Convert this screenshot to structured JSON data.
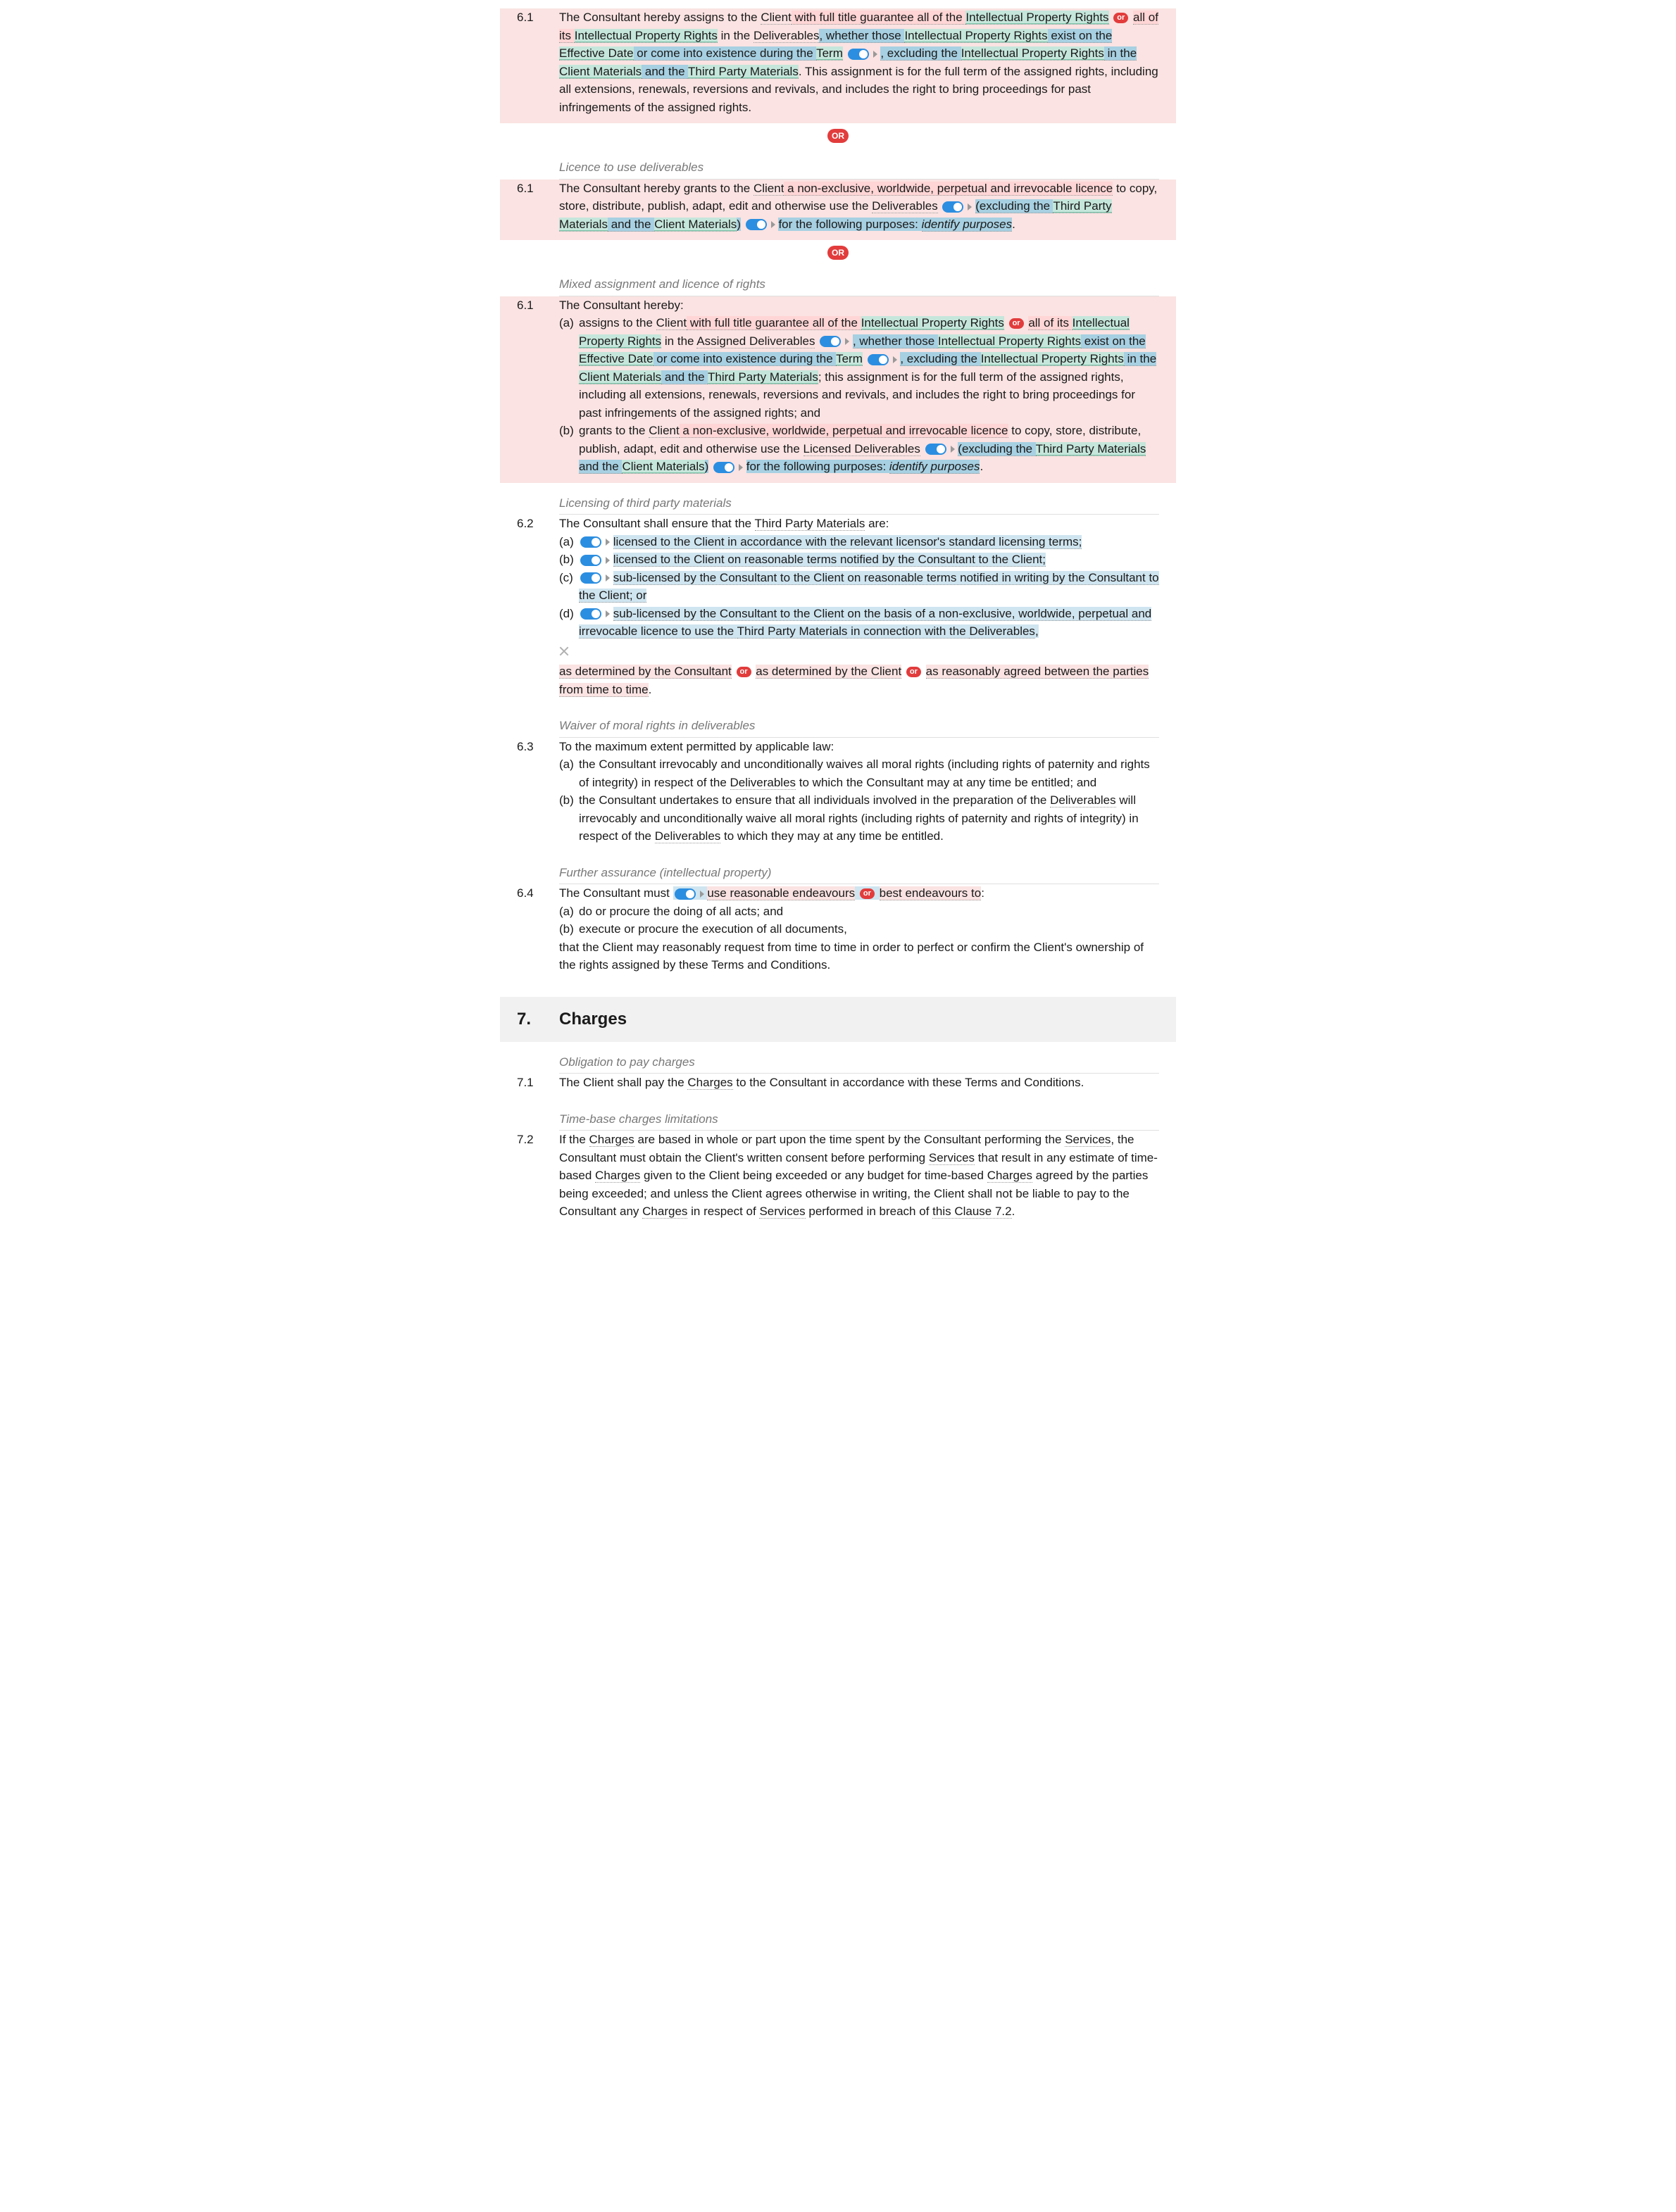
{
  "orLabel": "OR",
  "orLabelSmall": "or",
  "crossName": "remove-icon",
  "c61a": {
    "num": "6.1",
    "text": {
      "t1": "The Consultant hereby assigns to the ",
      "t2": "Client",
      "t3": " with full title guarantee all of the ",
      "t4": "Intellectual Property Rights",
      "t5": "all of its ",
      "t6": "Intellectual Property Rights",
      "t7": " in the ",
      "t8": "Deliverables",
      "t9": ", whether those ",
      "t10": "Intellectual Property Rights",
      "t11": " exist on the ",
      "t12": "Effective Date",
      "t13": " or come into existence during the ",
      "t14": "Term",
      "t15": ", excluding the ",
      "t16": "Intellectual Property Rights",
      "t17": " in the ",
      "t18": "Client Materials",
      "t19": " and the ",
      "t20": "Third Party Materials",
      "t21": ". This assignment is for the full term of the assigned rights, including all extensions, renewals, reversions and revivals, and includes the right to bring proceedings for past infringements of the assigned rights."
    }
  },
  "note_b": "Licence to use deliverables",
  "c61b": {
    "num": "6.1",
    "text": {
      "t1": "The Consultant hereby grants to the ",
      "t2": "Client",
      "t3": " a non-exclusive, worldwide, perpetual and irrevocable licence",
      "t4": " to copy, store, distribute, publish, adapt, edit and otherwise use the ",
      "t5": "Deliverables",
      "t6": "(excluding the ",
      "t7": "Third Party Materials",
      "t8": " and the ",
      "t9": "Client Materials",
      "t10": ")",
      "t11": "for the following purposes: ",
      "t12": "identify purposes",
      "t13": "."
    }
  },
  "note_c": "Mixed assignment and licence of rights",
  "c61c": {
    "num": "6.1",
    "intro": "The Consultant hereby:",
    "a": {
      "mark": "(a)",
      "t1": "assigns to the ",
      "t2": "Client",
      "t3": " with full title guarantee all of the ",
      "t4": "Intellectual Property Rights",
      "t5": "all of its ",
      "t6": "Intellectual Property Rights",
      "t7": " in the ",
      "t8": "Assigned Deliverables",
      "t9": ", whether those ",
      "t10": "Intellectual Property Rights",
      "t11": " exist on the ",
      "t12": "Effective Date",
      "t13": " or come into existence during the ",
      "t14": "Term",
      "t15": ", excluding the ",
      "t16": "Intellectual Property Rights",
      "t17": " in the ",
      "t18": "Client Materials",
      "t19": " and the ",
      "t20": "Third Party Materials",
      "t21": "; this assignment is for the full term of the assigned rights, including all extensions, renewals, reversions and revivals, and includes the right to bring proceedings for past infringements of the assigned rights; and"
    },
    "b": {
      "mark": "(b)",
      "t1": "grants to the ",
      "t2": "Client",
      "t3": " a non-exclusive, worldwide, perpetual and irrevocable licence",
      "t4": " to copy, store, distribute, publish, adapt, edit and otherwise use the ",
      "t5": "Licensed Deliverables",
      "t6": "(excluding the ",
      "t7": "Third Party Materials",
      "t8": " and the ",
      "t9": "Client Materials",
      "t10": ")",
      "t11": "for the following purposes: ",
      "t12": "identify purposes",
      "t13": "."
    }
  },
  "note_tpm": "Licensing of third party materials",
  "c62": {
    "num": "6.2",
    "intro_1": "The Consultant shall ensure that the ",
    "intro_2": "Third Party Materials",
    "intro_3": " are:",
    "a": {
      "mark": "(a)",
      "text": "licensed to the Client in accordance with the relevant licensor's standard licensing terms;"
    },
    "b": {
      "mark": "(b)",
      "text": "licensed to the Client on reasonable terms notified by the Consultant to the Client;"
    },
    "c": {
      "mark": "(c)",
      "text": "sub-licensed by the Consultant to the Client on reasonable terms notified in writing by the Consultant to the Client; or"
    },
    "d": {
      "mark": "(d)",
      "t1": "sub-licensed by the Consultant to the Client on the basis of a non-exclusive, worldwide, perpetual and irrevocable licence to use the ",
      "t2": "Third Party Materials",
      "t3": " in connection with the ",
      "t4": "Deliverables",
      "t5": ","
    },
    "tail": {
      "t1": "as determined by the Consultant",
      "t2": "as determined by the Client",
      "t3": "as reasonably agreed between the parties from time to time",
      "t4": "."
    }
  },
  "note_waiver": "Waiver of moral rights in deliverables",
  "c63": {
    "num": "6.3",
    "intro": "To the maximum extent permitted by applicable law:",
    "a": {
      "mark": "(a)",
      "t1": "the Consultant irrevocably and unconditionally waives all moral rights (including rights of paternity and rights of integrity) in respect of the ",
      "t2": "Deliverables",
      "t3": " to which the Consultant may at any time be entitled; and"
    },
    "b": {
      "mark": "(b)",
      "t1": "the Consultant undertakes to ensure that all individuals involved in the preparation of the ",
      "t2": "Deliverables",
      "t3": " will irrevocably and unconditionally waive all moral rights (including rights of paternity and rights of integrity) in respect of the ",
      "t4": "Deliverables",
      "t5": " to which they may at any time be entitled."
    }
  },
  "note_fa": "Further assurance (intellectual property)",
  "c64": {
    "num": "6.4",
    "intro_1": "The Consultant must ",
    "opt1": "use reasonable endeavours",
    "opt2": "best endeavours to",
    "intro_2": ":",
    "a": {
      "mark": "(a)",
      "text": "do or procure the doing of all acts; and"
    },
    "b": {
      "mark": "(b)",
      "text": "execute or procure the execution of all documents,"
    },
    "tail": "that the Client may reasonably request from time to time in order to perfect or confirm the Client's ownership of the rights assigned by these Terms and Conditions."
  },
  "section7": {
    "num": "7.",
    "title": "Charges"
  },
  "note_obl": "Obligation to pay charges",
  "c71": {
    "num": "7.1",
    "t1": "The Client shall pay the ",
    "t2": "Charges",
    "t3": " to the Consultant in accordance with these Terms and Conditions."
  },
  "note_tb": "Time-base charges limitations",
  "c72": {
    "num": "7.2",
    "t1": "If the ",
    "t2": "Charges",
    "t3": " are based in whole or part upon the time spent by the Consultant performing the ",
    "t4": "Services",
    "t5": ", the Consultant must obtain the Client's written consent before performing ",
    "t6": "Services",
    "t7": " that result in any estimate of time-based ",
    "t8": "Charges",
    "t9": " given to the Client being exceeded or any budget for time-based ",
    "t10": "Charges",
    "t11": " agreed by the parties being exceeded; and unless the Client agrees otherwise in writing, the Client shall not be liable to pay to the Consultant any ",
    "t12": "Charges",
    "t13": " in respect of ",
    "t14": "Services",
    "t15": " performed in breach of ",
    "t16": "this Clause 7.2",
    "t17": "."
  }
}
